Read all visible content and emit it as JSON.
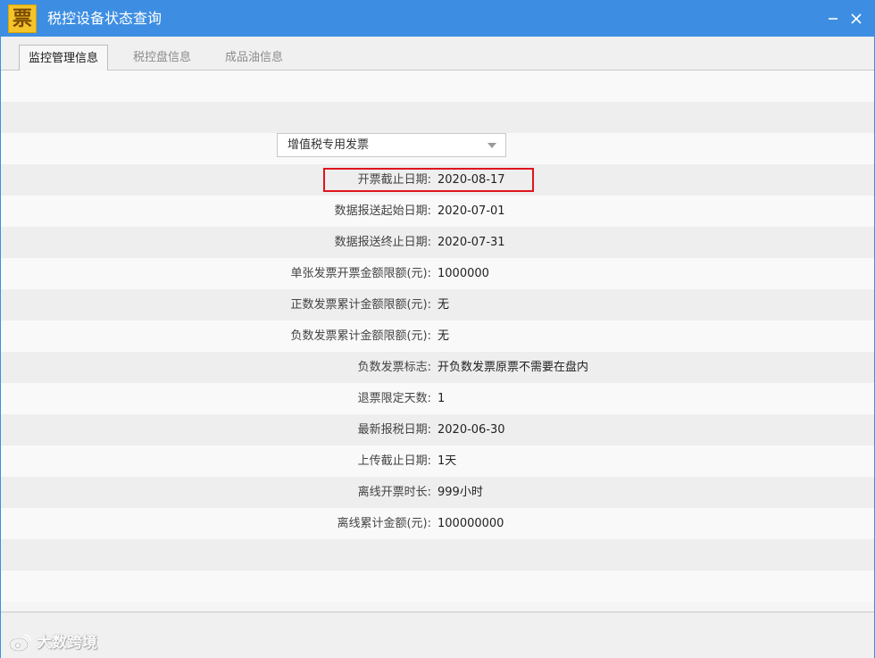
{
  "window": {
    "app_icon_glyph": "票",
    "title": "税控设备状态查询",
    "minimize_icon": "minimize-icon",
    "close_icon": "close-icon",
    "accent_color": "#3d8ee2"
  },
  "tabs": [
    {
      "label": "监控管理信息",
      "active": true
    },
    {
      "label": "税控盘信息",
      "active": false
    },
    {
      "label": "成品油信息",
      "active": false
    }
  ],
  "invoice_type": {
    "selected": "增值税专用发票",
    "arrow_icon": "dropdown-arrow-icon"
  },
  "fields": [
    {
      "label": "开票截止日期:",
      "value": "2020-08-17",
      "highlighted": true
    },
    {
      "label": "数据报送起始日期:",
      "value": "2020-07-01"
    },
    {
      "label": "数据报送终止日期:",
      "value": "2020-07-31"
    },
    {
      "label": "单张发票开票金额限额(元):",
      "value": "1000000"
    },
    {
      "label": "正数发票累计金额限额(元):",
      "value": "无"
    },
    {
      "label": "负数发票累计金额限额(元):",
      "value": "无"
    },
    {
      "label": "负数发票标志:",
      "value": "开负数发票原票不需要在盘内"
    },
    {
      "label": "退票限定天数:",
      "value": "1"
    },
    {
      "label": "最新报税日期:",
      "value": "2020-06-30"
    },
    {
      "label": "上传截止日期:",
      "value": "1天"
    },
    {
      "label": "离线开票时长:",
      "value": "999小时"
    },
    {
      "label": "离线累计金额(元):",
      "value": "100000000"
    }
  ],
  "highlight_color": "#e0141e",
  "watermark": {
    "text": "大数跨境",
    "icon": "weibo-logo-icon"
  }
}
